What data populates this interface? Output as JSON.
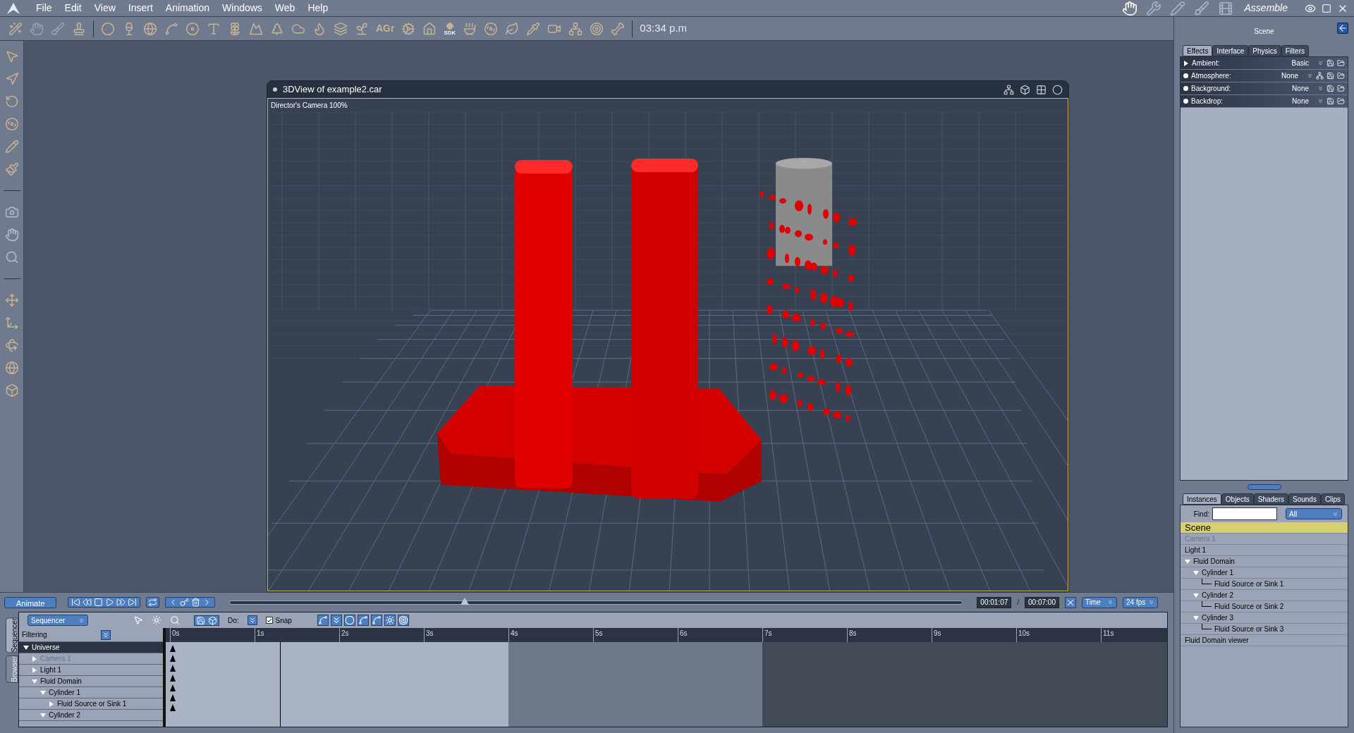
{
  "menu": [
    "File",
    "Edit",
    "View",
    "Insert",
    "Animation",
    "Windows",
    "Web",
    "Help"
  ],
  "rooms": {
    "items": [
      {
        "selected": true
      },
      {
        "selected": false
      },
      {
        "selected": false
      },
      {
        "selected": false
      },
      {
        "selected": false
      }
    ],
    "label": "Assemble"
  },
  "toolbar": {
    "agr_label": "AGr",
    "sdk_label": "SDK",
    "clock": "03:34 p.m"
  },
  "viewport": {
    "title": "3DView of example2.car",
    "camera_label": "Director's Camera 100%"
  },
  "scene_panel": {
    "title": "Scene",
    "tabs": [
      {
        "label": "Effects",
        "selected": true
      },
      {
        "label": "Interface",
        "selected": false
      },
      {
        "label": "Physics",
        "selected": false
      },
      {
        "label": "Filters",
        "selected": false
      }
    ],
    "effects": [
      {
        "kind": "expander",
        "label": "Ambient:",
        "value": "Basic",
        "extra_button": false
      },
      {
        "kind": "toggle",
        "label": "Atmosphere:",
        "value": "None",
        "extra_button": true
      },
      {
        "kind": "toggle",
        "label": "Background:",
        "value": "None",
        "extra_button": false
      },
      {
        "kind": "toggle",
        "label": "Backdrop:",
        "value": "None",
        "extra_button": false
      }
    ]
  },
  "instances_panel": {
    "tabs": [
      {
        "label": "Instances",
        "selected": true
      },
      {
        "label": "Objects",
        "selected": false
      },
      {
        "label": "Shaders",
        "selected": false
      },
      {
        "label": "Sounds",
        "selected": false
      },
      {
        "label": "Clips",
        "selected": false
      }
    ],
    "find_label": "Find:",
    "filter": "All",
    "tree": [
      {
        "label": "Scene",
        "selected": true,
        "greyed": false
      },
      {
        "label": "Camera 1",
        "selected": false,
        "greyed": true
      },
      {
        "label": "Light 1",
        "selected": false,
        "greyed": false
      },
      {
        "label": "Fluid Domain",
        "selected": false,
        "greyed": false,
        "expanded": true,
        "children": [
          {
            "label": "Cylinder 1",
            "selected": false,
            "greyed": false,
            "expanded": true,
            "children": [
              {
                "label": "Fluid Source or Sink 1",
                "selected": false,
                "greyed": false
              }
            ]
          },
          {
            "label": "Cylinder 2",
            "selected": false,
            "greyed": false,
            "expanded": true,
            "children": [
              {
                "label": "Fluid Source or Sink 2",
                "selected": false,
                "greyed": false
              }
            ]
          },
          {
            "label": "Cylinder 3",
            "selected": false,
            "greyed": false,
            "expanded": true,
            "children": [
              {
                "label": "Fluid Source or Sink 3",
                "selected": false,
                "greyed": false
              }
            ]
          }
        ]
      },
      {
        "label": "Fluid Domain viewer",
        "selected": false,
        "greyed": false
      }
    ]
  },
  "animation": {
    "animate_button": "Animate",
    "scrub": {
      "level": 0.32
    },
    "current_time": "00:01:07",
    "separator": "/",
    "total_time": "00:07:00",
    "time_mode": "Time",
    "fps": "24 fps"
  },
  "timeline": {
    "side_tabs": [
      {
        "label": "Sequencer",
        "selected": true
      },
      {
        "label": "Browser",
        "selected": false
      }
    ],
    "mode": "Sequencer",
    "filtering": "Filtering",
    "do_label": "Do:",
    "snap": {
      "label": "Snap",
      "checked": true
    },
    "ruler": [
      "0s",
      "1s",
      "2s",
      "3s",
      "4s",
      "5s",
      "6s",
      "7s",
      "8s",
      "9s",
      "10s",
      "11s"
    ],
    "tracks": [
      {
        "label": "Universe",
        "greyed": false,
        "expanded": true,
        "children": [
          {
            "label": "Camera 1",
            "greyed": true,
            "expanded": false
          },
          {
            "label": "Light 1",
            "greyed": false,
            "expanded": false
          },
          {
            "label": "Fluid Domain",
            "greyed": false,
            "expanded": true,
            "children": [
              {
                "label": "Cylinder 1",
                "greyed": false,
                "expanded": true,
                "children": [
                  {
                    "label": "Fluid Source or Sink 1",
                    "greyed": false,
                    "expanded": false
                  }
                ]
              },
              {
                "label": "Cylinder 2",
                "greyed": false,
                "expanded": true
              }
            ]
          }
        ]
      }
    ]
  }
}
